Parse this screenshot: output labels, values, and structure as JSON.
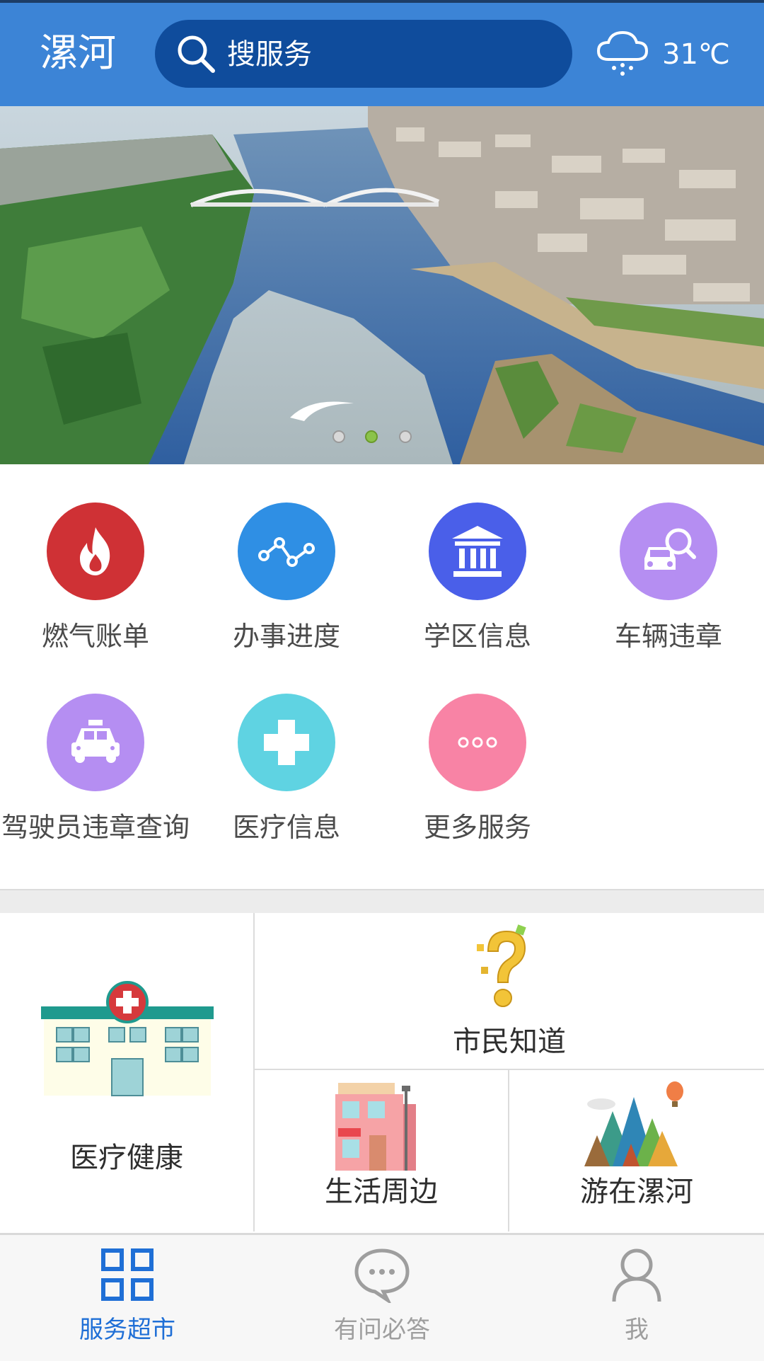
{
  "header": {
    "city": "漯河",
    "search_placeholder": "搜服务",
    "temperature": "31℃",
    "weather_icon": "cloud-rain-icon"
  },
  "banner": {
    "slides": 3,
    "active_slide": 2
  },
  "services": [
    {
      "label": "燃气账单",
      "icon": "flame-icon",
      "color": "#cf3135"
    },
    {
      "label": "办事进度",
      "icon": "progress-line-icon",
      "color": "#2f8fe4"
    },
    {
      "label": "学区信息",
      "icon": "school-building-icon",
      "color": "#4a5fe9"
    },
    {
      "label": "车辆违章",
      "icon": "car-search-icon",
      "color": "#b58ef2"
    },
    {
      "label": "驾驶员违章查询",
      "icon": "taxi-icon",
      "color": "#b58ef2"
    },
    {
      "label": "医疗信息",
      "icon": "medical-cross-icon",
      "color": "#5fd3e2"
    },
    {
      "label": "更多服务",
      "icon": "more-dots-icon",
      "color": "#f883a5"
    }
  ],
  "tiles": {
    "health": "医疗健康",
    "citizen_know": "市民知道",
    "life_around": "生活周边",
    "tour": "游在漯河"
  },
  "bottom_nav": [
    {
      "label": "服务超市",
      "icon": "grid-icon",
      "active": true
    },
    {
      "label": "有问必答",
      "icon": "chat-bubble-icon",
      "active": false
    },
    {
      "label": "我",
      "icon": "person-icon",
      "active": false
    }
  ],
  "colors": {
    "header": "#3c84d6",
    "search_bg": "#0f4c9c",
    "nav_active": "#1f6fd6",
    "nav_inactive": "#9e9e9e"
  }
}
